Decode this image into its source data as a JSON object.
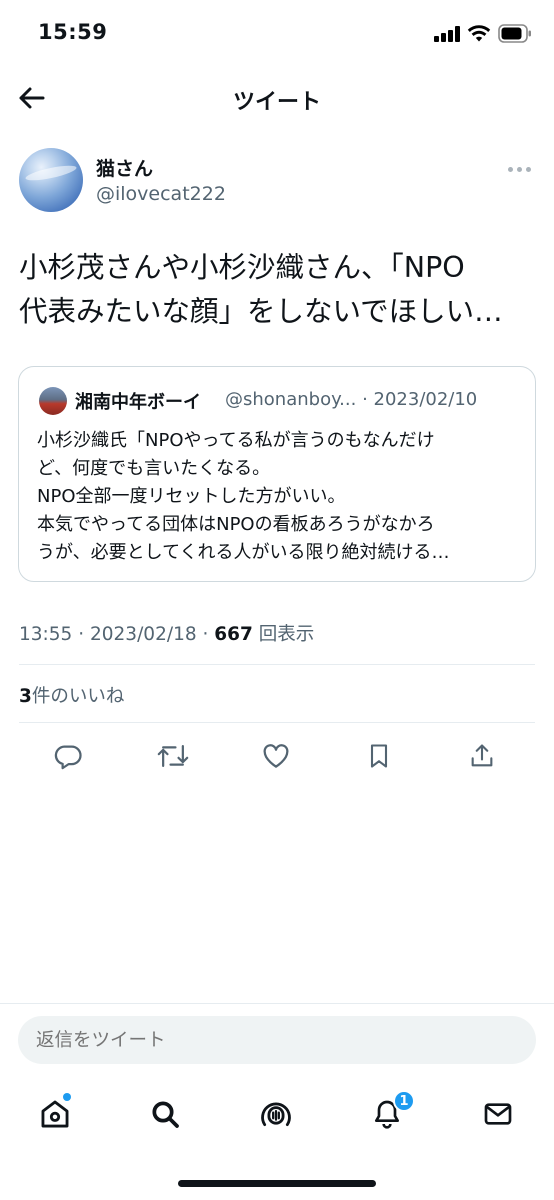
{
  "status_bar": {
    "time": "15:59"
  },
  "header": {
    "title": "ツイート"
  },
  "author": {
    "name": "猫さん",
    "handle": "@ilovecat222"
  },
  "tweet": {
    "text": "小杉茂さんや小杉沙織さん、「NPO\n代表みたいな顔」をしないでほしい…",
    "time": "13:55",
    "date": "2023/02/18",
    "views_count": "667",
    "views_label": "回表示",
    "likes_count": "3",
    "likes_label": "件のいいね"
  },
  "quoted_tweet": {
    "name": "湘南中年ボーイ",
    "handle": "@shonanboy...",
    "date": "2023/02/10",
    "text": "小杉沙織氏「NPOやってる私が言うのもなんだけ\nど、何度でも言いたくなる。\nNPO全部一度リセットした方がいい。\n本気でやってる団体はNPOの看板あろうがなかろ\nうが、必要としてくれる人がいる限り絶対続ける…"
  },
  "actions": [
    "reply-icon",
    "retweet-icon",
    "like-icon",
    "bookmark-icon",
    "share-icon"
  ],
  "reply_box": {
    "placeholder": "返信をツイート"
  },
  "tabbar": {
    "items": [
      "home-icon",
      "search-icon",
      "spaces-icon",
      "notifications-icon",
      "messages-icon"
    ],
    "notifications_badge": "1"
  },
  "colors": {
    "accent": "#1d9bf0",
    "text": "#0f1419",
    "secondary": "#536471",
    "border": "#cfd9de"
  }
}
